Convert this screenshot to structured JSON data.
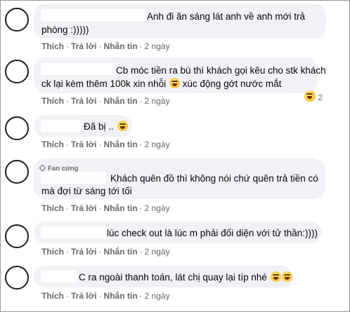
{
  "comments": [
    {
      "lines": [
        "Anh đi ăn sáng lát anh về anh mới trả",
        "phòng :)))))"
      ],
      "actions": {
        "like": "Thích",
        "reply": "Trả lời",
        "message": "Nhắn tin",
        "time": "2 ngày"
      }
    },
    {
      "lines": [
        "Cb móc tiền ra bù thì khách gọi kêu cho stk khách",
        "ck lại kèm thêm 100k xin nhỗi",
        "xúc động gớt nước mắt"
      ],
      "actions": {
        "like": "Thích",
        "reply": "Trả lời",
        "message": "Nhắn tin",
        "time": "2 ngày"
      },
      "reaction_count": "2"
    },
    {
      "lines": [
        "Đã bị .."
      ],
      "actions": {
        "like": "Thích",
        "reply": "Trả lời",
        "message": "Nhắn tin",
        "time": "2 ngày"
      }
    },
    {
      "badge": "Fan cứng",
      "lines": [
        "Khách quên đồ thì không nói chứ quên trả tiền có",
        "mà đợi từ sáng tới tối"
      ],
      "actions": {
        "like": "Thích",
        "reply": "Trả lời",
        "message": "Nhắn tin",
        "time": "2 ngày"
      }
    },
    {
      "lines": [
        "lúc check out là lúc m phải đối diện với tử thần:))))"
      ],
      "actions": {
        "like": "Thích",
        "reply": "Trả lời",
        "message": "Nhắn tin",
        "time": "2 ngày"
      }
    },
    {
      "lines": [
        "C ra ngoài thanh toán, lát chị quay lại típ nhé"
      ],
      "actions": {
        "like": "Thích",
        "reply": "Trả lời",
        "message": "Nhắn tin",
        "time": "2 ngày"
      }
    }
  ]
}
